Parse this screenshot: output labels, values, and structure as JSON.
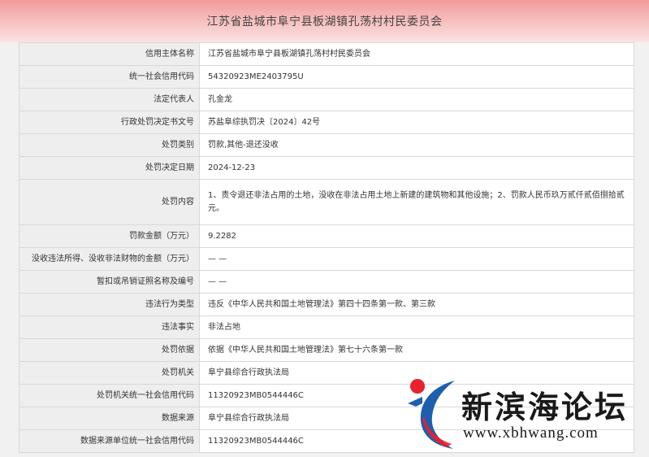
{
  "header": {
    "title": "江苏省盐城市阜宁县板湖镇孔荡村村民委员会"
  },
  "rows": [
    {
      "label": "信用主体名称",
      "value": "江苏省盐城市阜宁县板湖镇孔荡村村民委员会"
    },
    {
      "label": "统一社会信用代码",
      "value": "54320923ME2403795U"
    },
    {
      "label": "法定代表人",
      "value": "孔金龙"
    },
    {
      "label": "行政处罚决定书文号",
      "value": "苏盐阜综执罚决〔2024〕42号"
    },
    {
      "label": "处罚类别",
      "value": "罚款,其他-退还没收"
    },
    {
      "label": "处罚决定日期",
      "value": "2024-12-23"
    },
    {
      "label": "处罚内容",
      "value": "1、责令退还非法占用的土地，没收在非法占用土地上新建的建筑物和其他设施；2、罚款人民币玖万贰仟贰佰捌拾贰元。"
    },
    {
      "label": "罚款金额（万元）",
      "value": "9.2282"
    },
    {
      "label": "没收违法所得、没收非法财物的金额（万元）",
      "value": "— —"
    },
    {
      "label": "暂扣或吊销证照名称及编号",
      "value": "— —"
    },
    {
      "label": "违法行为类型",
      "value": "违反《中华人民共和国土地管理法》第四十四条第一款、第三款"
    },
    {
      "label": "违法事实",
      "value": "非法占地"
    },
    {
      "label": "处罚依据",
      "value": "依据《中华人民共和国土地管理法》第七十六条第一款"
    },
    {
      "label": "处罚机关",
      "value": "阜宁县综合行政执法局"
    },
    {
      "label": "处罚机关统一社会信用代码",
      "value": "11320923MB0544446C"
    },
    {
      "label": "数据来源",
      "value": "阜宁县综合行政执法局"
    },
    {
      "label": "数据来源单位统一社会信用代码",
      "value": "11320923MB0544446C"
    }
  ],
  "watermark": {
    "name": "新滨海论坛",
    "url": "www.xbhwang.com",
    "logo_icon": "xbh-logo-icon",
    "colors": {
      "red": "#e8212e",
      "blue": "#1d5fae"
    }
  }
}
